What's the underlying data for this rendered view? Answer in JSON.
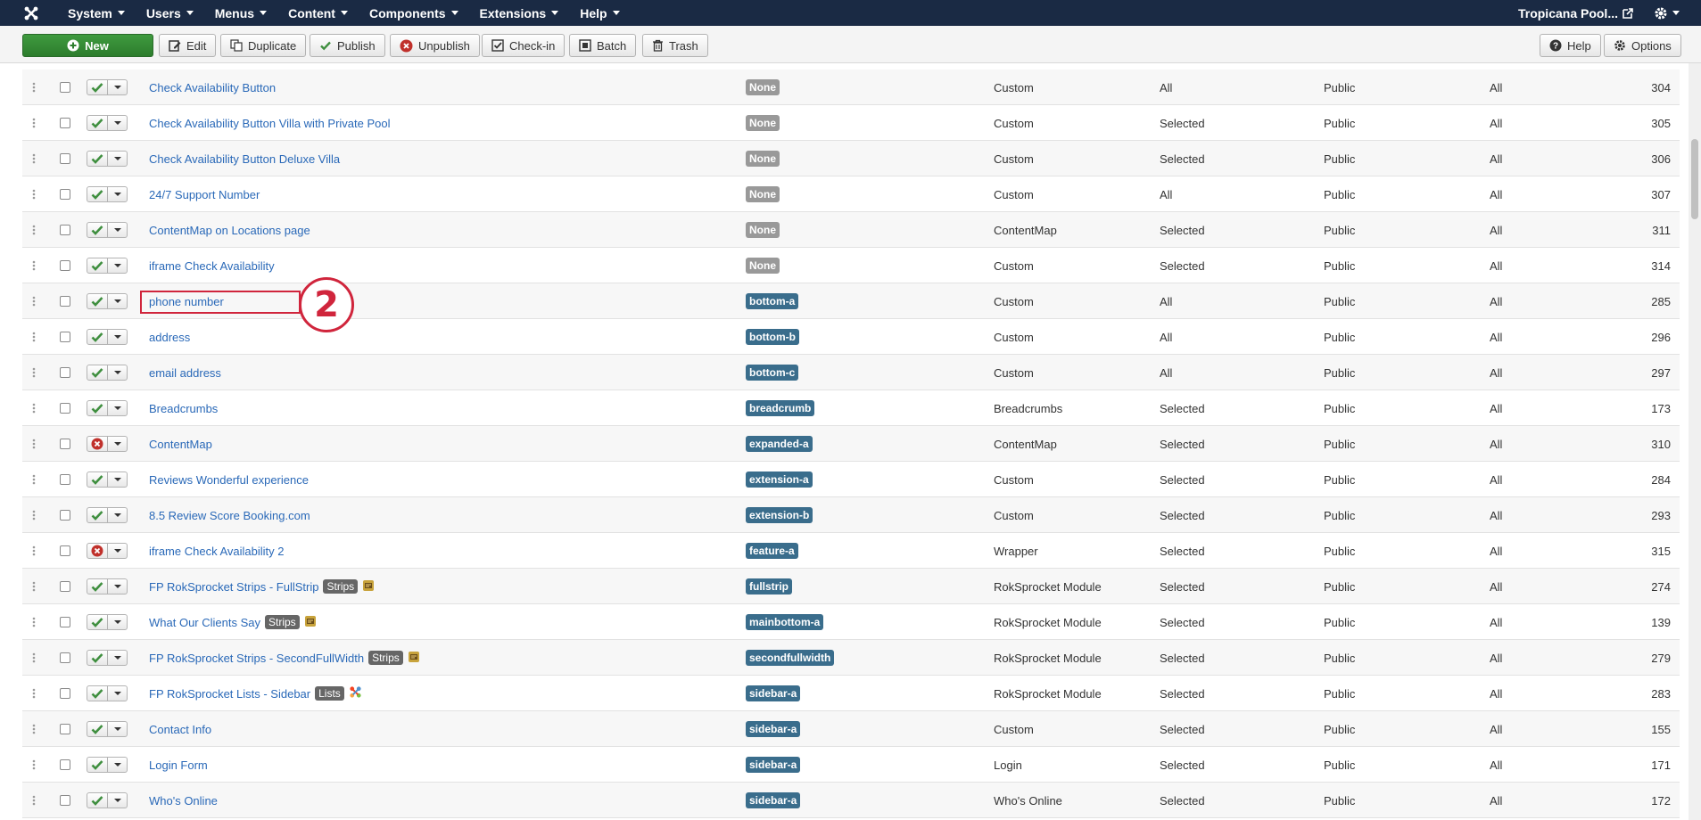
{
  "nav": {
    "menu": [
      "System",
      "Users",
      "Menus",
      "Content",
      "Components",
      "Extensions",
      "Help"
    ],
    "site_name": "Tropicana Pool..."
  },
  "toolbar": {
    "new": "New",
    "edit": "Edit",
    "duplicate": "Duplicate",
    "publish": "Publish",
    "unpublish": "Unpublish",
    "checkin": "Check-in",
    "batch": "Batch",
    "trash": "Trash",
    "help": "Help",
    "options": "Options"
  },
  "rows": [
    {
      "title": "Check Availability Button",
      "position": "None",
      "type": "Custom",
      "pages": "All",
      "access": "Public",
      "language": "All",
      "id": "304",
      "published": true
    },
    {
      "title": "Check Availability Button Villa with Private Pool",
      "position": "None",
      "type": "Custom",
      "pages": "Selected",
      "access": "Public",
      "language": "All",
      "id": "305",
      "published": true
    },
    {
      "title": "Check Availability Button Deluxe Villa",
      "position": "None",
      "type": "Custom",
      "pages": "Selected",
      "access": "Public",
      "language": "All",
      "id": "306",
      "published": true
    },
    {
      "title": "24/7 Support Number",
      "position": "None",
      "type": "Custom",
      "pages": "All",
      "access": "Public",
      "language": "All",
      "id": "307",
      "published": true
    },
    {
      "title": "ContentMap on Locations page",
      "position": "None",
      "type": "ContentMap",
      "pages": "Selected",
      "access": "Public",
      "language": "All",
      "id": "311",
      "published": true
    },
    {
      "title": "iframe Check Availability",
      "position": "None",
      "type": "Custom",
      "pages": "Selected",
      "access": "Public",
      "language": "All",
      "id": "314",
      "published": true
    },
    {
      "title": "phone number",
      "position": "bottom-a",
      "type": "Custom",
      "pages": "All",
      "access": "Public",
      "language": "All",
      "id": "285",
      "published": true
    },
    {
      "title": "address",
      "position": "bottom-b",
      "type": "Custom",
      "pages": "All",
      "access": "Public",
      "language": "All",
      "id": "296",
      "published": true
    },
    {
      "title": "email address",
      "position": "bottom-c",
      "type": "Custom",
      "pages": "All",
      "access": "Public",
      "language": "All",
      "id": "297",
      "published": true
    },
    {
      "title": "Breadcrumbs",
      "position": "breadcrumb",
      "type": "Breadcrumbs",
      "pages": "Selected",
      "access": "Public",
      "language": "All",
      "id": "173",
      "published": true
    },
    {
      "title": "ContentMap",
      "position": "expanded-a",
      "type": "ContentMap",
      "pages": "Selected",
      "access": "Public",
      "language": "All",
      "id": "310",
      "published": false
    },
    {
      "title": "Reviews Wonderful experience",
      "position": "extension-a",
      "type": "Custom",
      "pages": "Selected",
      "access": "Public",
      "language": "All",
      "id": "284",
      "published": true
    },
    {
      "title": "8.5 Review Score Booking.com",
      "position": "extension-b",
      "type": "Custom",
      "pages": "Selected",
      "access": "Public",
      "language": "All",
      "id": "293",
      "published": true
    },
    {
      "title": "iframe Check Availability 2",
      "position": "feature-a",
      "type": "Wrapper",
      "pages": "Selected",
      "access": "Public",
      "language": "All",
      "id": "315",
      "published": false
    },
    {
      "title": "FP RokSprocket Strips - FullStrip",
      "note": "Strips",
      "position": "fullstrip",
      "type": "RokSprocket Module",
      "pages": "Selected",
      "access": "Public",
      "language": "All",
      "id": "274",
      "published": true,
      "icon": "rss"
    },
    {
      "title": "What Our Clients Say",
      "note": "Strips",
      "position": "mainbottom-a",
      "type": "RokSprocket Module",
      "pages": "Selected",
      "access": "Public",
      "language": "All",
      "id": "139",
      "published": true,
      "icon": "rss"
    },
    {
      "title": "FP RokSprocket Strips - SecondFullWidth",
      "note": "Strips",
      "position": "secondfullwidth",
      "type": "RokSprocket Module",
      "pages": "Selected",
      "access": "Public",
      "language": "All",
      "id": "279",
      "published": true,
      "icon": "rss"
    },
    {
      "title": "FP RokSprocket Lists - Sidebar",
      "note": "Lists",
      "position": "sidebar-a",
      "type": "RokSprocket Module",
      "pages": "Selected",
      "access": "Public",
      "language": "All",
      "id": "283",
      "published": true,
      "icon": "joomla"
    },
    {
      "title": "Contact Info",
      "position": "sidebar-a",
      "type": "Custom",
      "pages": "Selected",
      "access": "Public",
      "language": "All",
      "id": "155",
      "published": true
    },
    {
      "title": "Login Form",
      "position": "sidebar-a",
      "type": "Login",
      "pages": "Selected",
      "access": "Public",
      "language": "All",
      "id": "171",
      "published": true
    },
    {
      "title": "Who's Online",
      "position": "sidebar-a",
      "type": "Who's Online",
      "pages": "Selected",
      "access": "Public",
      "language": "All",
      "id": "172",
      "published": true
    }
  ],
  "annotation": {
    "label": "2",
    "row": 6
  },
  "colors": {
    "nav_bg": "#1a2a44",
    "link": "#2a69b8",
    "position_badge": "#3a6d8c",
    "none_badge": "#999999",
    "published": "#3f8f3f",
    "unpublished": "#c0302b",
    "annotation": "#d0253c"
  }
}
